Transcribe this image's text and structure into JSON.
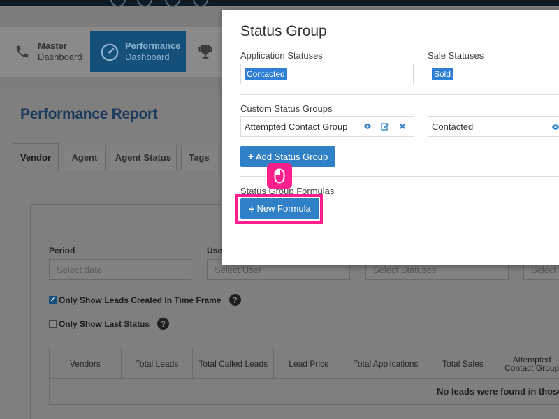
{
  "nav": {
    "items": [
      {
        "line1": "Master",
        "line2": "Dashboard",
        "icon": "phone-icon"
      },
      {
        "line1": "Performance",
        "line2": "Dashboard",
        "icon": "speedometer-icon"
      },
      {
        "icon": "trophy-icon"
      }
    ]
  },
  "report": {
    "title": "Performance Report",
    "tabs": [
      "Vendor",
      "Agent",
      "Agent Status",
      "Tags"
    ]
  },
  "filters": {
    "period_label": "Period",
    "period_placeholder": "Select date",
    "user_label": "User",
    "user_placeholder": "Select User",
    "statuses_placeholder": "Select Statuses",
    "fourth_placeholder": "Select"
  },
  "options": {
    "only_created": {
      "label": "Only Show Leads Created In Time Frame",
      "checked": true
    },
    "only_last_status": {
      "label": "Only Show Last Status",
      "checked": false
    },
    "help_glyph": "?"
  },
  "table": {
    "columns": [
      "Vendors",
      "Total Leads",
      "Total Called Leads",
      "Lead Price",
      "Total Applications",
      "Total Sales",
      "Attempted Contact Group"
    ],
    "empty_message": "No leads were found in those"
  },
  "modal": {
    "title": "Status Group",
    "application_statuses_label": "Application Statuses",
    "application_statuses_value": "Contacted",
    "sale_statuses_label": "Sale Statuses",
    "sale_statuses_value": "Sold",
    "custom_groups_label": "Custom Status Groups",
    "custom_groups": [
      {
        "name": "Attempted Contact Group",
        "statuses": "Contacted"
      }
    ],
    "add_group_button": "Add Status Group",
    "formulas_label": "Status Group Formulas",
    "new_formula_button": "New Formula"
  },
  "colors": {
    "accent_blue": "#2f80c6",
    "highlight_pink": "#ff1e8e",
    "selection_blue": "#2f7fd6"
  }
}
